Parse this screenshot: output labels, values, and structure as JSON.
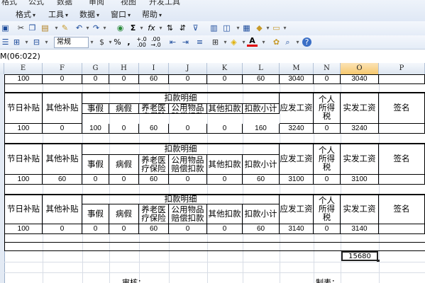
{
  "menubar": {
    "top_cut_items": [
      "格式",
      "公式",
      "数据",
      "审阅",
      "视图",
      "开发工具"
    ],
    "items": [
      "格式",
      "工具",
      "数据",
      "窗口",
      "帮助"
    ]
  },
  "toolbar": {
    "style_value": "常规",
    "percent_label": "%",
    "comma_label": ",",
    "inc_decimal_label": "+.0\n.00",
    "dec_decimal_label": ".00\n→.0",
    "sigma_label": "Σ",
    "fx_label": "fx",
    "font_color_label": "A"
  },
  "formula_bar": {
    "text": "M(06:022)"
  },
  "columns": {
    "labels": [
      "E",
      "F",
      "G",
      "H",
      "I",
      "J",
      "K",
      "L",
      "M",
      "N",
      "O",
      "P"
    ],
    "active": "O"
  },
  "sheet": {
    "headers": {
      "holiday_subsidy": "节日补贴",
      "other_subsidy": "其他补贴",
      "deduction_detail": "扣款明细",
      "personal_leave": "事假",
      "sick_leave": "病假",
      "pension_medical": "养老医疗保险",
      "public_goods": "公用物品赔偿扣款",
      "other_deduction": "其他扣款",
      "deduction_subtotal": "扣款小计",
      "wage_payable": "应发工资",
      "income_tax": "个人所得税",
      "actual_wage": "实发工资",
      "signature": "签名"
    },
    "rows": [
      [
        "100",
        "0",
        "0",
        "0",
        "60",
        "0",
        "0",
        "60",
        "3040",
        "0",
        "3040"
      ],
      [
        "100",
        "0",
        "100",
        "0",
        "60",
        "0",
        "0",
        "160",
        "3240",
        "0",
        "3240"
      ],
      [
        "100",
        "60",
        "0",
        "0",
        "60",
        "0",
        "0",
        "60",
        "3100",
        "0",
        "3100"
      ],
      [
        "100",
        "0",
        "0",
        "0",
        "60",
        "0",
        "0",
        "60",
        "3140",
        "0",
        "3140"
      ]
    ],
    "total": "15680",
    "footer": {
      "reviewer": "审核：",
      "preparer": "制表："
    }
  }
}
